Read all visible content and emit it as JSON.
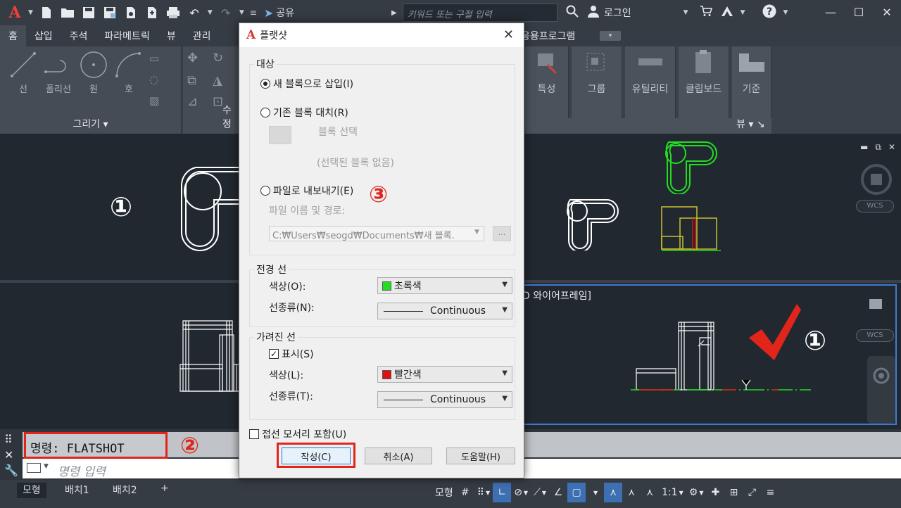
{
  "titlebar": {
    "share_label": "공유",
    "search_placeholder": "키워드 또는 구절 입력",
    "login_label": "로그인",
    "help_label": "?"
  },
  "ribbon_tabs": [
    "홈",
    "삽입",
    "주석",
    "파라메트릭",
    "뷰",
    "관리"
  ],
  "ribbon_tabs_right": "응용프로그램",
  "ribbon": {
    "draw_panel_title": "그리기",
    "modify_panel_title": "수정",
    "tools": {
      "line": "선",
      "polyline": "폴리선",
      "circle": "원",
      "arc": "호"
    },
    "right_panels": [
      "특성",
      "그룹",
      "유틸리티",
      "클립보드",
      "기준"
    ],
    "view_label": "뷰"
  },
  "drawing": {
    "vp_label": "D 와이어프레임]",
    "wcs_label": "WCS",
    "y_axis": "Y",
    "circle_one_left": "①",
    "circle_one_right": "①"
  },
  "command": {
    "history_text": "명령:  FLATSHOT",
    "input_placeholder": "명령 입력",
    "badge_two": "②"
  },
  "layout_tabs": [
    "모형",
    "배치1",
    "배치2"
  ],
  "add_tab": "+",
  "status": {
    "model_label": "모형",
    "scale_label": "1:1"
  },
  "dialog": {
    "title": "플랫샷",
    "badge_three": "③",
    "destination": {
      "legend": "대상",
      "insert_new": "새 블록으로 삽입(I)",
      "replace_existing": "기존 블록 대치(R)",
      "select_block": "블록 선택",
      "no_block_selected": "(선택된 블록 없음)",
      "export_file": "파일로 내보내기(E)",
      "filename_label": "파일 이름 및 경로:",
      "filename_value": "C:₩Users₩seogd₩Documents₩새 블록.",
      "browse_label": "..."
    },
    "foreground": {
      "legend": "전경 선",
      "color_label": "색상(O):",
      "color_value": "초록색",
      "color_hex": "#22dd22",
      "linetype_label": "선종류(N):",
      "linetype_value": "Continuous"
    },
    "obscured": {
      "legend": "가려진 선",
      "show_label": "표시(S)",
      "color_label": "색상(L):",
      "color_value": "빨간색",
      "color_hex": "#dd1111",
      "linetype_label": "선종류(T):",
      "linetype_value": "Continuous"
    },
    "tangential_edges": "접선 모서리 포함(U)",
    "buttons": {
      "create": "작성(C)",
      "cancel": "취소(A)",
      "help": "도움말(H)"
    }
  }
}
